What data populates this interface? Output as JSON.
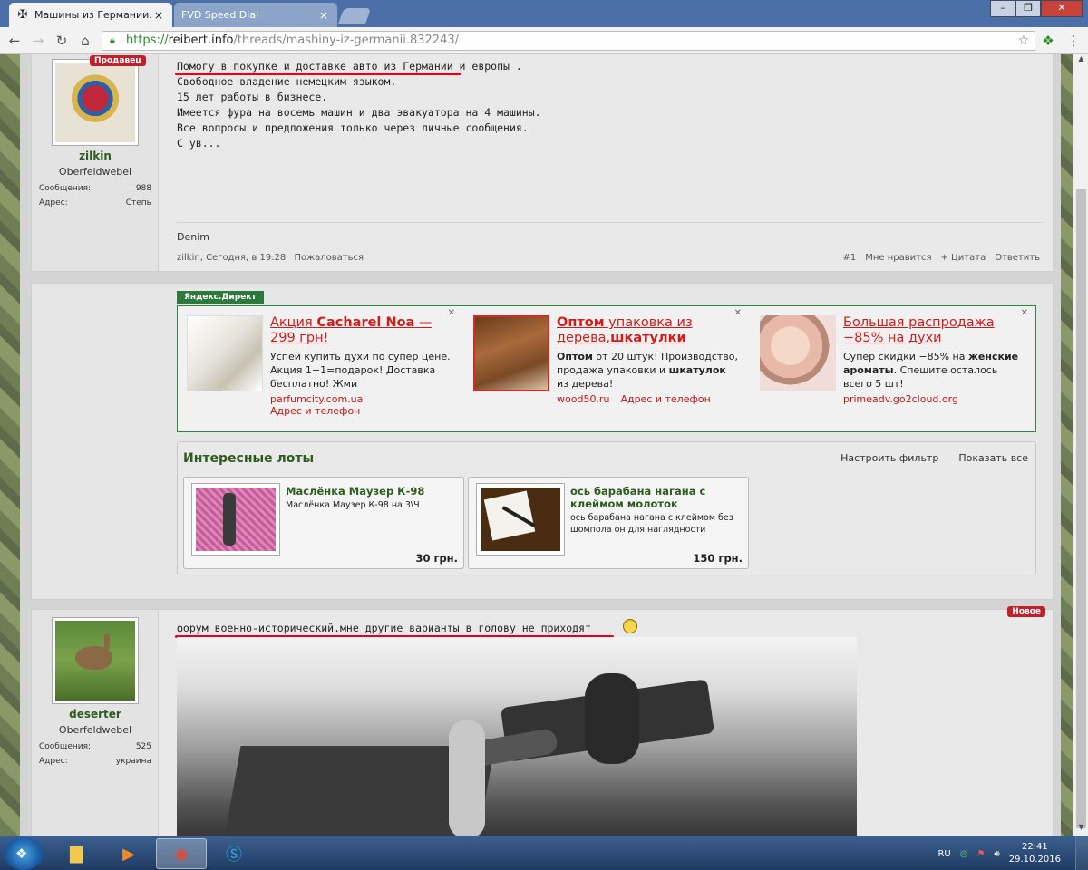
{
  "browser": {
    "tabs": [
      {
        "title": "Машины из Германии. |",
        "favicon": "iron-cross-icon",
        "active": true
      },
      {
        "title": "FVD Speed Dial",
        "favicon": "",
        "active": false
      }
    ],
    "url_scheme": "https://",
    "url_host": "reibert.info",
    "url_path": "/threads/mashiny-iz-germanii.832243/"
  },
  "post1": {
    "badge": "Продавец",
    "username": "zilkin",
    "user_title": "Oberfeldwebel",
    "stats": [
      {
        "label": "Сообщения:",
        "value": "988"
      },
      {
        "label": "Адрес:",
        "value": "Степь"
      }
    ],
    "lines": [
      "Помогу в покупке и доставке авто из Германии и европы .",
      "Свободное владение немецким языком.",
      "15 лет работы в бизнесе.",
      "Имеется фура на восемь машин и два эвакуатора на 4 машины.",
      "Все вопросы и предложения только через личные сообщения.",
      "С ув..."
    ],
    "signature": "Denim",
    "meta_author": "zilkin, Сегодня, в 19:28",
    "report": "Пожаловаться",
    "actions": [
      "#1",
      "Мне нравится",
      "+ Цитата",
      "Ответить"
    ]
  },
  "ads": {
    "label": "Яндекс.Директ",
    "items": [
      {
        "headline_a": "Акция ",
        "headline_b": "Cacharel Noa",
        "headline_c": " — 299 грн!",
        "body": "Успей купить духи по супер цене. Акция 1+1=подарок! Доставка бесплатно! Жми",
        "domain": "parfumcity.com.ua",
        "address": "Адрес и телефон"
      },
      {
        "headline_a": "Оптом",
        "headline_b": " упаковка из дерева,",
        "headline_c": "шкатулки",
        "body_a": "Оптом",
        "body_b": " от 20 штук! Производство, продажа упаковки и ",
        "body_c": "шкатулок",
        "body_d": " из дерева!",
        "domain": "wood50.ru",
        "address": "Адрес и телефон"
      },
      {
        "headline": "Большая распродажа −85% на духи",
        "body_a": "Супер скидки −85% на ",
        "body_b": "женские ароматы",
        "body_c": ". Спешите осталось всего 5 шт!",
        "domain": "primeadv.go2cloud.org"
      }
    ]
  },
  "lots": {
    "title": "Интересные лоты",
    "filter_link": "Настроить фильтр",
    "show_all_link": "Показать все",
    "items": [
      {
        "name": "Маслёнка Маузер К-98",
        "desc": "Маслёнка Маузер К-98 на 3\\Ч",
        "price": "30 грн."
      },
      {
        "name": "ось барабана нагана с клеймом молоток",
        "desc": "ось барабана нагана с клеймом без шомпола он для наглядности",
        "price": "150 грн."
      }
    ]
  },
  "post2": {
    "badge": "Новое",
    "username": "deserter",
    "user_title": "Oberfeldwebel",
    "stats": [
      {
        "label": "Сообщения:",
        "value": "525"
      },
      {
        "label": "Адрес:",
        "value": "украина"
      }
    ],
    "text": "форум военно-исторический.мне другие варианты в голову не приходят"
  },
  "taskbar": {
    "lang": "RU",
    "time": "22:41",
    "date": "29.10.2016"
  },
  "colors": {
    "accent_red": "#d31b1b",
    "forum_green": "#2e5c1e",
    "ydx_green": "#2a7a3a"
  }
}
